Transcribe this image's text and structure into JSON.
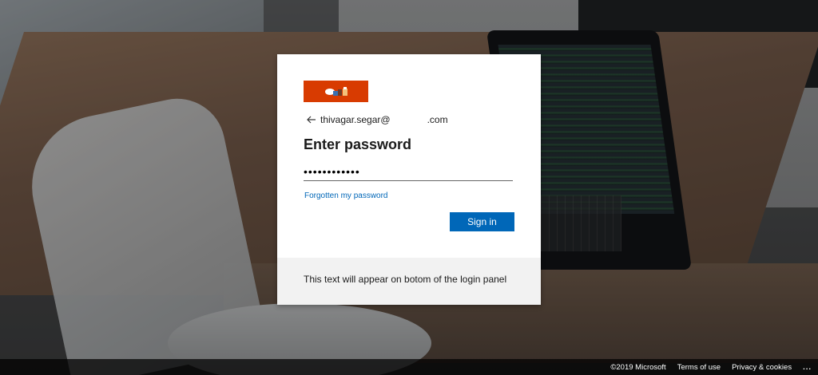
{
  "login": {
    "email_prefix": "thivagar.segar@",
    "email_suffix": ".com",
    "title": "Enter password",
    "password_mask": "••••••••••••",
    "forgot_label": "Forgotten my password",
    "signin_label": "Sign in",
    "footer_text": "This text will appear on botom of the login panel"
  },
  "footer": {
    "copyright": "©2019 Microsoft",
    "terms": "Terms of use",
    "privacy": "Privacy & cookies",
    "more": "..."
  },
  "icons": {
    "back": "back-arrow-icon",
    "logo": "company-logo",
    "more": "more-options-icon"
  },
  "colors": {
    "accent": "#0067b8",
    "logo_bg": "#d83b01",
    "panel": "#ffffff",
    "panel_footer": "#f2f2f2"
  }
}
